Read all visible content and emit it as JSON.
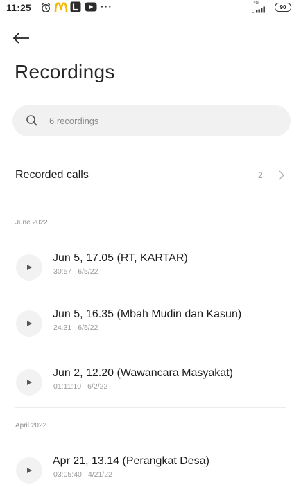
{
  "status_bar": {
    "time": "11:25",
    "more": "···",
    "network": "4G",
    "battery": "90",
    "icons": [
      "alarm-clock-icon",
      "mcdonalds-app-icon",
      "linkedin-app-icon",
      "youtube-app-icon",
      "signal-icon",
      "battery-icon"
    ]
  },
  "header": {
    "back_icon": "back-arrow-icon",
    "title": "Recordings"
  },
  "search": {
    "placeholder": "6 recordings",
    "icon": "search-icon"
  },
  "recorded_calls": {
    "label": "Recorded calls",
    "count": "2",
    "icon": "chevron-right-icon"
  },
  "sections": [
    {
      "header": "June 2022",
      "items": [
        {
          "title": "Jun 5, 17.05 (RT, KARTAR)",
          "duration": "30:57",
          "date": "6/5/22"
        },
        {
          "title": "Jun 5, 16.35 (Mbah Mudin dan Kasun)",
          "duration": "24:31",
          "date": "6/5/22"
        },
        {
          "title": "Jun 2, 12.20 (Wawancara Masyakat)",
          "duration": "01:11:10",
          "date": "6/2/22"
        }
      ]
    },
    {
      "header": "April 2022",
      "items": [
        {
          "title": "Apr 21, 13.14 (Perangkat Desa)",
          "duration": "03:05:40",
          "date": "4/21/22"
        }
      ]
    }
  ],
  "colors": {
    "background": "#ffffff",
    "search_bg": "#f1f1f1",
    "play_bg": "#f2f2f2",
    "secondary_text": "#9a9a9a",
    "mcdonalds_yellow": "#f5b800",
    "linkedin_dark": "#2b2b2b",
    "youtube_dark": "#2b2b2b"
  }
}
